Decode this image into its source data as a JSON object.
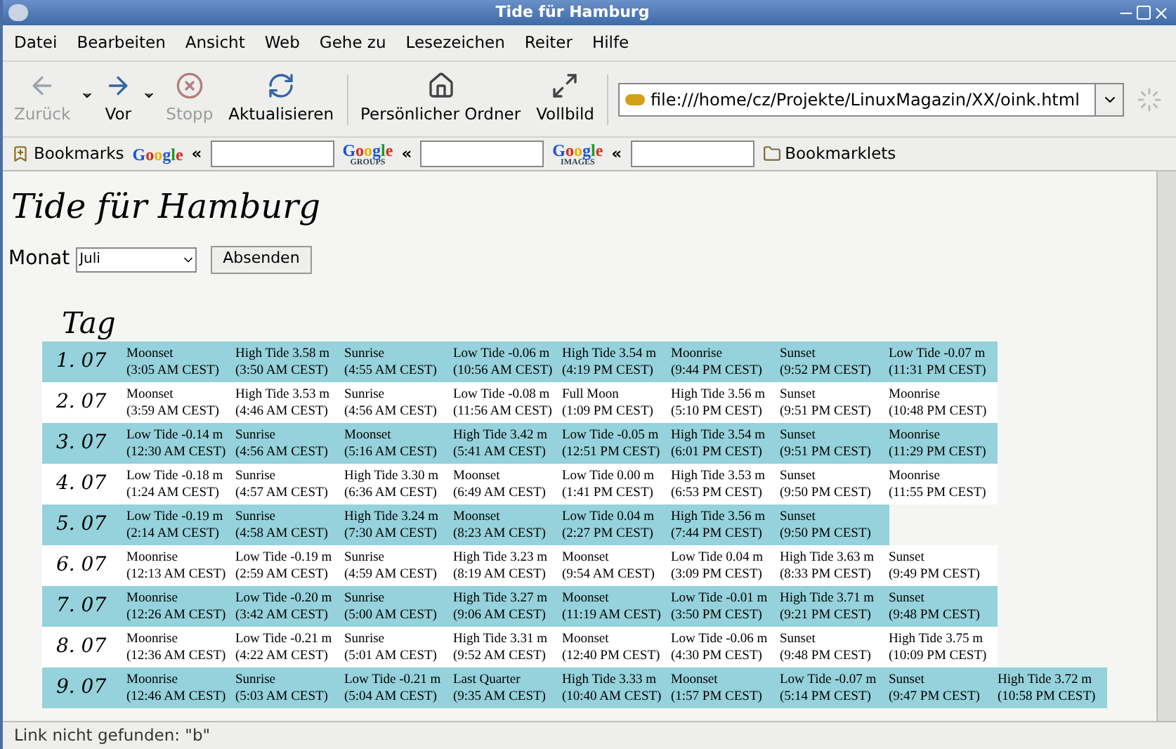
{
  "window": {
    "title": "Tide für Hamburg"
  },
  "menu": [
    "Datei",
    "Bearbeiten",
    "Ansicht",
    "Web",
    "Gehe zu",
    "Lesezeichen",
    "Reiter",
    "Hilfe"
  ],
  "toolbar": {
    "buttons": [
      {
        "kind": "back",
        "label": "Zurück",
        "disabled": true,
        "dropdown": true
      },
      {
        "kind": "forward",
        "label": "Vor",
        "disabled": false,
        "dropdown": true
      },
      {
        "kind": "stop",
        "label": "Stopp",
        "disabled": true
      },
      {
        "kind": "reload",
        "label": "Aktualisieren",
        "disabled": false
      },
      {
        "kind": "home",
        "label": "Persönlicher Ordner",
        "disabled": false
      },
      {
        "kind": "fullscreen",
        "label": "Vollbild",
        "disabled": false
      }
    ],
    "address": "file:///home/cz/Projekte/LinuxMagazin/XX/oink.html"
  },
  "bookmarks_bar": {
    "bookmarks": "Bookmarks",
    "searches": [
      {
        "logo": "Google",
        "arrow": "«"
      },
      {
        "logo": "Google",
        "sub": "GROUPS",
        "arrow": "«"
      },
      {
        "logo": "Google",
        "sub": "IMAGES",
        "arrow": "«"
      }
    ],
    "folder": "Bookmarklets"
  },
  "page": {
    "heading": "Tide für Hamburg",
    "month_label": "Monat",
    "month": "Juli",
    "submit": "Absenden",
    "day_header": "Tag",
    "rows": [
      {
        "date": "1. 07",
        "events": [
          {
            "event": "Moonset",
            "time": "(3:05 AM CEST)"
          },
          {
            "event": "High Tide 3.58 m",
            "time": "(3:50 AM CEST)"
          },
          {
            "event": "Sunrise",
            "time": "(4:55 AM CEST)"
          },
          {
            "event": "Low Tide -0.06 m",
            "time": "(10:56 AM CEST)"
          },
          {
            "event": "High Tide 3.54 m",
            "time": "(4:19 PM CEST)"
          },
          {
            "event": "Moonrise",
            "time": "(9:44 PM CEST)"
          },
          {
            "event": "Sunset",
            "time": "(9:52 PM CEST)"
          },
          {
            "event": "Low Tide -0.07 m",
            "time": "(11:31 PM CEST)"
          }
        ]
      },
      {
        "date": "2. 07",
        "events": [
          {
            "event": "Moonset",
            "time": "(3:59 AM CEST)"
          },
          {
            "event": "High Tide 3.53 m",
            "time": "(4:46 AM CEST)"
          },
          {
            "event": "Sunrise",
            "time": "(4:56 AM CEST)"
          },
          {
            "event": "Low Tide -0.08 m",
            "time": "(11:56 AM CEST)"
          },
          {
            "event": "Full Moon",
            "time": "(1:09 PM CEST)"
          },
          {
            "event": "High Tide 3.56 m",
            "time": "(5:10 PM CEST)"
          },
          {
            "event": "Sunset",
            "time": "(9:51 PM CEST)"
          },
          {
            "event": "Moonrise",
            "time": "(10:48 PM CEST)"
          }
        ]
      },
      {
        "date": "3. 07",
        "events": [
          {
            "event": "Low Tide -0.14 m",
            "time": "(12:30 AM CEST)"
          },
          {
            "event": "Sunrise",
            "time": "(4:56 AM CEST)"
          },
          {
            "event": "Moonset",
            "time": "(5:16 AM CEST)"
          },
          {
            "event": "High Tide 3.42 m",
            "time": "(5:41 AM CEST)"
          },
          {
            "event": "Low Tide -0.05 m",
            "time": "(12:51 PM CEST)"
          },
          {
            "event": "High Tide 3.54 m",
            "time": "(6:01 PM CEST)"
          },
          {
            "event": "Sunset",
            "time": "(9:51 PM CEST)"
          },
          {
            "event": "Moonrise",
            "time": "(11:29 PM CEST)"
          }
        ]
      },
      {
        "date": "4. 07",
        "events": [
          {
            "event": "Low Tide -0.18 m",
            "time": "(1:24 AM CEST)"
          },
          {
            "event": "Sunrise",
            "time": "(4:57 AM CEST)"
          },
          {
            "event": "High Tide 3.30 m",
            "time": "(6:36 AM CEST)"
          },
          {
            "event": "Moonset",
            "time": "(6:49 AM CEST)"
          },
          {
            "event": "Low Tide 0.00 m",
            "time": "(1:41 PM CEST)"
          },
          {
            "event": "High Tide 3.53 m",
            "time": "(6:53 PM CEST)"
          },
          {
            "event": "Sunset",
            "time": "(9:50 PM CEST)"
          },
          {
            "event": "Moonrise",
            "time": "(11:55 PM CEST)"
          }
        ]
      },
      {
        "date": "5. 07",
        "events": [
          {
            "event": "Low Tide -0.19 m",
            "time": "(2:14 AM CEST)"
          },
          {
            "event": "Sunrise",
            "time": "(4:58 AM CEST)"
          },
          {
            "event": "High Tide 3.24 m",
            "time": "(7:30 AM CEST)"
          },
          {
            "event": "Moonset",
            "time": "(8:23 AM CEST)"
          },
          {
            "event": "Low Tide 0.04 m",
            "time": "(2:27 PM CEST)"
          },
          {
            "event": "High Tide 3.56 m",
            "time": "(7:44 PM CEST)"
          },
          {
            "event": "Sunset",
            "time": "(9:50 PM CEST)"
          }
        ]
      },
      {
        "date": "6. 07",
        "events": [
          {
            "event": "Moonrise",
            "time": "(12:13 AM CEST)"
          },
          {
            "event": "Low Tide -0.19 m",
            "time": "(2:59 AM CEST)"
          },
          {
            "event": "Sunrise",
            "time": "(4:59 AM CEST)"
          },
          {
            "event": "High Tide 3.23 m",
            "time": "(8:19 AM CEST)"
          },
          {
            "event": "Moonset",
            "time": "(9:54 AM CEST)"
          },
          {
            "event": "Low Tide 0.04 m",
            "time": "(3:09 PM CEST)"
          },
          {
            "event": "High Tide 3.63 m",
            "time": "(8:33 PM CEST)"
          },
          {
            "event": "Sunset",
            "time": "(9:49 PM CEST)"
          }
        ]
      },
      {
        "date": "7. 07",
        "events": [
          {
            "event": "Moonrise",
            "time": "(12:26 AM CEST)"
          },
          {
            "event": "Low Tide -0.20 m",
            "time": "(3:42 AM CEST)"
          },
          {
            "event": "Sunrise",
            "time": "(5:00 AM CEST)"
          },
          {
            "event": "High Tide 3.27 m",
            "time": "(9:06 AM CEST)"
          },
          {
            "event": "Moonset",
            "time": "(11:19 AM CEST)"
          },
          {
            "event": "Low Tide -0.01 m",
            "time": "(3:50 PM CEST)"
          },
          {
            "event": "High Tide 3.71 m",
            "time": "(9:21 PM CEST)"
          },
          {
            "event": "Sunset",
            "time": "(9:48 PM CEST)"
          }
        ]
      },
      {
        "date": "8. 07",
        "events": [
          {
            "event": "Moonrise",
            "time": "(12:36 AM CEST)"
          },
          {
            "event": "Low Tide -0.21 m",
            "time": "(4:22 AM CEST)"
          },
          {
            "event": "Sunrise",
            "time": "(5:01 AM CEST)"
          },
          {
            "event": "High Tide 3.31 m",
            "time": "(9:52 AM CEST)"
          },
          {
            "event": "Moonset",
            "time": "(12:40 PM CEST)"
          },
          {
            "event": "Low Tide -0.06 m",
            "time": "(4:30 PM CEST)"
          },
          {
            "event": "Sunset",
            "time": "(9:48 PM CEST)"
          },
          {
            "event": "High Tide 3.75 m",
            "time": "(10:09 PM CEST)"
          }
        ]
      },
      {
        "date": "9. 07",
        "events": [
          {
            "event": "Moonrise",
            "time": "(12:46 AM CEST)"
          },
          {
            "event": "Sunrise",
            "time": "(5:03 AM CEST)"
          },
          {
            "event": "Low Tide -0.21 m",
            "time": "(5:04 AM CEST)"
          },
          {
            "event": "Last Quarter",
            "time": "(9:35 AM CEST)"
          },
          {
            "event": "High Tide 3.33 m",
            "time": "(10:40 AM CEST)"
          },
          {
            "event": "Moonset",
            "time": "(1:57 PM CEST)"
          },
          {
            "event": "Low Tide -0.07 m",
            "time": "(5:14 PM CEST)"
          },
          {
            "event": "Sunset",
            "time": "(9:47 PM CEST)"
          },
          {
            "event": "High Tide 3.72 m",
            "time": "(10:58 PM CEST)"
          }
        ]
      }
    ]
  },
  "status_bar": "Link nicht gefunden: \"b\""
}
